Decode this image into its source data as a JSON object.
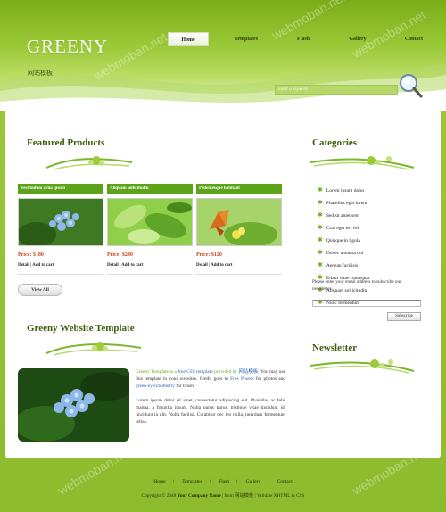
{
  "header": {
    "logo": "GREENY",
    "logo_sub": "网站模板",
    "nav": [
      {
        "label": "Home",
        "active": true
      },
      {
        "label": "Templates",
        "active": false
      },
      {
        "label": "Flash",
        "active": false
      },
      {
        "label": "Gallery",
        "active": false
      },
      {
        "label": "Contact",
        "active": false
      }
    ],
    "search_placeholder": "Enter a keyword"
  },
  "featured": {
    "title": "Featured Products",
    "products": [
      {
        "name": "Vestibulum urna ipsum",
        "price": "Price: $180",
        "detail": "Detail",
        "add": "Add to cart"
      },
      {
        "name": "Aliquam sollicitudin",
        "price": "Price: $240",
        "detail": "Detail",
        "add": "Add to cart"
      },
      {
        "name": "Pellentesque habitant",
        "price": "Price: $120",
        "detail": "Detail",
        "add": "Add to cart"
      }
    ],
    "view_all": "View All"
  },
  "categories": {
    "title": "Categories",
    "items": [
      "Lorem ipsum dolor",
      "Phasellus eget lorem",
      "Sed sit amet sem",
      "Cras eget est vel",
      "Quisque in ligula",
      "Donec a massa dui",
      "Aenean facilisis",
      "Etiam vitae consequat",
      "Aliquam sollicitudin",
      "Nunc fermentum"
    ]
  },
  "template_section": {
    "title": "Greeny Website Template",
    "p1_a": "Greeny Template is a ",
    "p1_link1": "free CSS template",
    "p1_b": " provided by ",
    "p1_link2": "网站模板",
    "p1_c": ". You may use this template in your websites. Credit goes to ",
    "p1_link3": "Free Photos",
    "p1_d": " for photos and ",
    "p1_link4": "green-eyed/butterfly",
    "p1_e": " for brush.",
    "p2": "Lorem ipsum dolor sit amet, consectetur adipiscing elit. Phasellus ac felis magna, a fringilla ipsum. Nulla purus purus, tristique vitae tincidunt id, tincidunt in elit. Nulla facilisi. Curabitur nec leo nulla, interdum fermentum tellus."
  },
  "newsletter": {
    "title": "Newsletter",
    "text": "Please enter your email address to subscribe our newsletter.",
    "button": "Subscribe"
  },
  "footer": {
    "nav": [
      "Home",
      "Templates",
      "Flash",
      "Gallery",
      "Contact"
    ],
    "copyright_a": "Copyright © 2048 ",
    "copyright_company": "Your Company Name",
    "copyright_b": " | from ",
    "copyright_link": "网站模板",
    "copyright_c": " | Validate XHTML & CSS"
  },
  "watermark": "webmoban.net",
  "colors": {
    "brand_green": "#5ba319",
    "price_red": "#d0461c",
    "title_green": "#3d5c0c"
  }
}
